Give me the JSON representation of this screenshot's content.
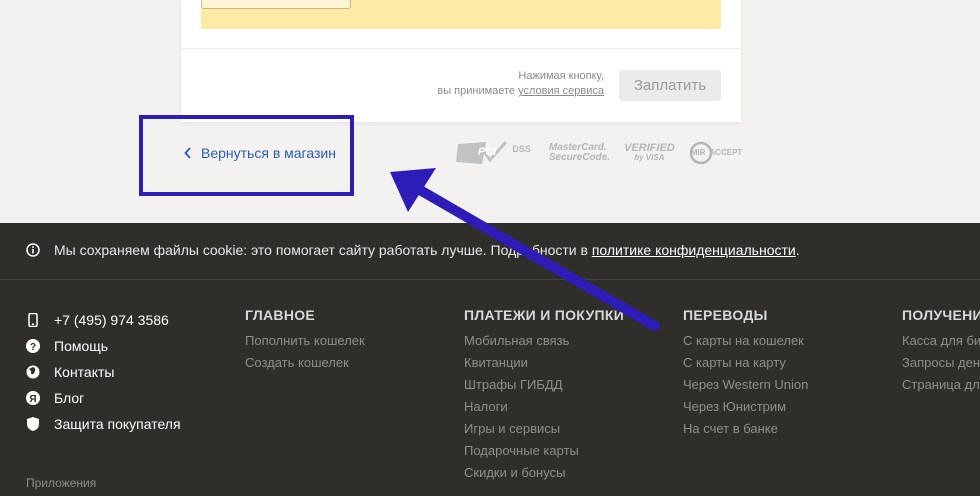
{
  "payment": {
    "terms_line1": "Нажимая кнопку,",
    "terms_prefix": "вы принимаете ",
    "terms_link": "условия сервиса",
    "pay_button": "Заплатить"
  },
  "back_link": "Вернуться в магазин",
  "logos": {
    "pci": "PCI",
    "pci_dss": "DSS",
    "mastercard_line1": "MasterCard.",
    "mastercard_line2": "SecureCode.",
    "visa_line1": "VERIFIED",
    "visa_line2": "by VISA",
    "mir": "MIR",
    "mir_accept": "ACCEPT"
  },
  "cookie": {
    "text": "Мы сохраняем файлы cookie: это помогает сайту работать лучше. Подробности в ",
    "link": "политике конфиденциальности",
    "suffix": "."
  },
  "contacts": [
    {
      "icon": "phone-icon",
      "label": "+7 (495) 974 3586"
    },
    {
      "icon": "help-icon",
      "label": "Помощь"
    },
    {
      "icon": "globe-icon",
      "label": "Контакты"
    },
    {
      "icon": "blog-icon",
      "label": "Блог"
    },
    {
      "icon": "shield-icon",
      "label": "Защита покупателя"
    }
  ],
  "columns": [
    {
      "title": "ГЛАВНОЕ",
      "links": [
        "Пополнить кошелек",
        "Создать кошелек"
      ]
    },
    {
      "title": "ПЛАТЕЖИ И ПОКУПКИ",
      "links": [
        "Мобильная связь",
        "Квитанции",
        "Штрафы ГИБДД",
        "Налоги",
        "Игры и сервисы",
        "Подарочные карты",
        "Скидки и бонусы"
      ]
    },
    {
      "title": "ПЕРЕВОДЫ",
      "links": [
        "С карты на кошелек",
        "С карты на карту",
        "Через Western Union",
        "Через Юнистрим",
        "На счет в банке"
      ]
    },
    {
      "title": "ПОЛУЧЕНИ",
      "links": [
        "Касса для би",
        "Запросы ден",
        "Страница дл"
      ]
    }
  ],
  "apps": "Приложения",
  "colors": {
    "annotation": "#2d1cb8",
    "link": "#2b5cb4",
    "footer_bg": "#2f2e2b"
  }
}
